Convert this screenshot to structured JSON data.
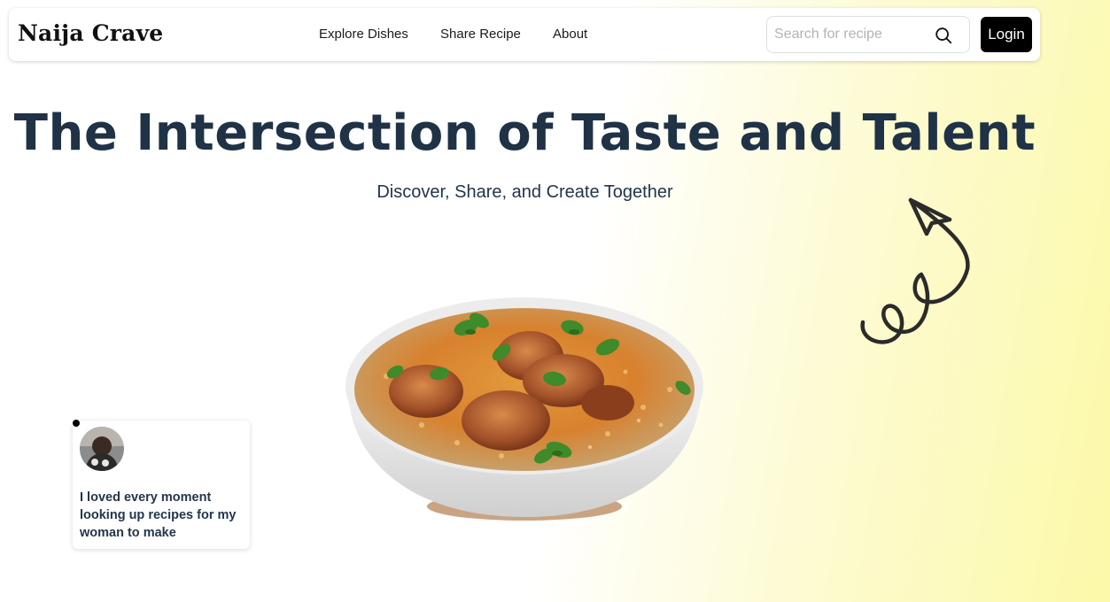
{
  "brand": {
    "name": "Naija Crave"
  },
  "nav": {
    "links": [
      "Explore Dishes",
      "Share Recipe",
      "About"
    ]
  },
  "search": {
    "placeholder": "Search for recipe",
    "value": ""
  },
  "login": {
    "label": "Login"
  },
  "hero": {
    "title": "The Intersection of Taste and Talent",
    "subtitle": "Discover, Share, and Create Together"
  },
  "testimonial": {
    "text": "I loved every moment looking up recipes for my woman to make"
  },
  "colors": {
    "heading": "#1f3246",
    "gradient_end": "#fcf9a8",
    "login_bg": "#000000"
  },
  "icons": {
    "search": "search-icon",
    "arrow": "curly-arrow-icon"
  }
}
